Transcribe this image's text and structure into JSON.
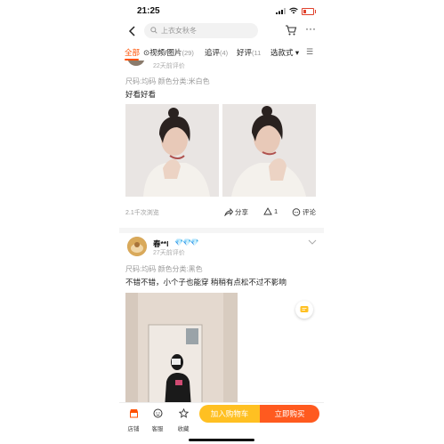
{
  "status_bar": {
    "time": "21:25"
  },
  "search": {
    "placeholder": "上衣女秋冬"
  },
  "tabs": [
    {
      "label": "全部",
      "count": ""
    },
    {
      "label": "⊙视频/图片",
      "count": "(29)"
    },
    {
      "label": "追评",
      "count": "(4)"
    },
    {
      "label": "好评",
      "count": "(11"
    },
    {
      "label": "选款式 ▾",
      "count": ""
    }
  ],
  "review1": {
    "date": "22天前评价",
    "sku": "尺码:均码 颜色分类:米白色",
    "text": "好看好看",
    "views": "2.1千次浏览",
    "share_label": "分享",
    "like_count": "1",
    "comment_label": "评论"
  },
  "review2": {
    "username": "春**l",
    "badges": "💎💎💎",
    "date": "27天前评价",
    "sku": "尺码:均码 颜色分类:黑色",
    "text": "不错不错，小个子也能穿 稍稍有点松不过不影响"
  },
  "bottom_bar": {
    "store_label": "店铺",
    "service_label": "客服",
    "favorite_label": "收藏",
    "add_to_cart": "加入购物车",
    "buy_now": "立即购买"
  },
  "colors": {
    "accent": "#ff5000",
    "cart_button": "#ffc022",
    "buy_button": "#ff5a1f"
  }
}
